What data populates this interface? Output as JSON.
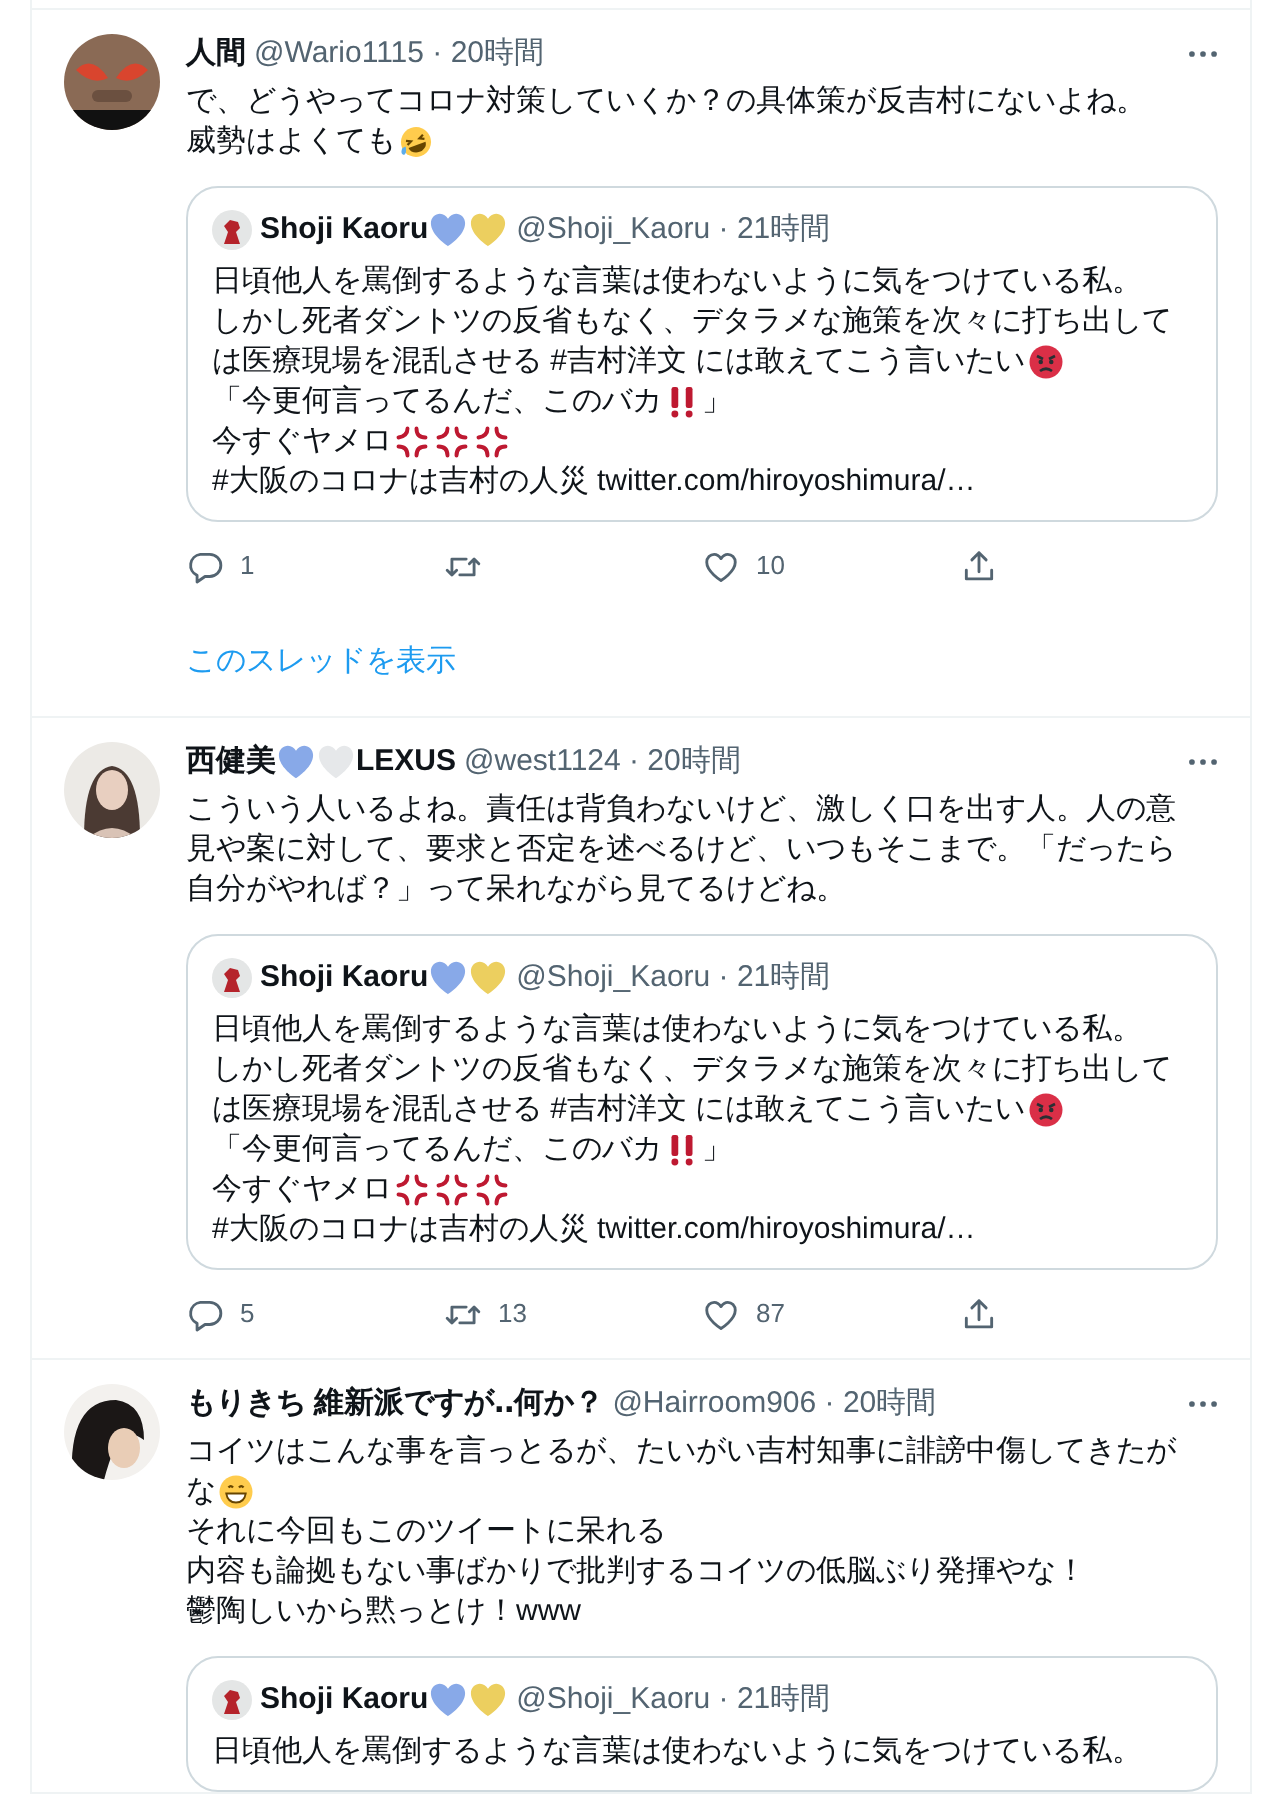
{
  "tweets": [
    {
      "author": {
        "name": [
          {
            "kind": "text",
            "text": "人間"
          }
        ],
        "meta": "@Wario1115 · 20時間"
      },
      "body": [
        [
          {
            "kind": "text",
            "text": "で、どうやってコロナ対策していくか？の具体策が反吉村にないよね。"
          }
        ],
        [
          {
            "kind": "text",
            "text": "威勢はよくても"
          },
          {
            "kind": "laugh"
          }
        ]
      ],
      "quote": {
        "name": [
          {
            "kind": "text",
            "text": "Shoji Kaoru"
          },
          {
            "kind": "heart",
            "color": "#88a9e8"
          },
          {
            "kind": "heart",
            "color": "#eccf5f"
          }
        ],
        "meta": "@Shoji_Kaoru · 21時間",
        "body": [
          [
            {
              "kind": "text",
              "text": "日頃他人を罵倒するような言葉は使わないように気をつけている私。"
            }
          ],
          [
            {
              "kind": "text",
              "text": "しかし死者ダントツの反省もなく、デタラメな施策を次々に打ち出して"
            }
          ],
          [
            {
              "kind": "text",
              "text": "は医療現場を混乱させる #吉村洋文 には敢えてこう言いたい"
            },
            {
              "kind": "angry"
            }
          ],
          [
            {
              "kind": "text",
              "text": "「今更何言ってるんだ、このバカ"
            },
            {
              "kind": "bangbang"
            },
            {
              "kind": "text",
              "text": "」"
            }
          ],
          [
            {
              "kind": "text",
              "text": "今すぐヤメロ"
            },
            {
              "kind": "anger"
            },
            {
              "kind": "anger"
            },
            {
              "kind": "anger"
            }
          ],
          [
            {
              "kind": "text",
              "text": "#大阪のコロナは吉村の人災 twitter.com/hiroyoshimura/…"
            }
          ]
        ]
      },
      "actions": [
        {
          "kind": "reply",
          "count": "1"
        },
        {
          "kind": "retweet"
        },
        {
          "kind": "like",
          "count": "10"
        },
        {
          "kind": "share"
        }
      ],
      "thread_link": "このスレッドを表示"
    },
    {
      "author": {
        "name": [
          {
            "kind": "text",
            "text": "西健美"
          },
          {
            "kind": "heart",
            "color": "#88a9e8"
          },
          {
            "kind": "heart",
            "color": "#e6e8ea"
          },
          {
            "kind": "text",
            "text": "LEXUS"
          }
        ],
        "meta": "@west1124 · 20時間"
      },
      "body": [
        [
          {
            "kind": "text",
            "text": "こういう人いるよね。責任は背負わないけど、激しく口を出す人。人の意"
          }
        ],
        [
          {
            "kind": "text",
            "text": "見や案に対して、要求と否定を述べるけど、いつもそこまで。「だったら"
          }
        ],
        [
          {
            "kind": "text",
            "text": "自分がやれば？」って呆れながら見てるけどね。"
          }
        ]
      ],
      "quote": {
        "name": [
          {
            "kind": "text",
            "text": "Shoji Kaoru"
          },
          {
            "kind": "heart",
            "color": "#88a9e8"
          },
          {
            "kind": "heart",
            "color": "#eccf5f"
          }
        ],
        "meta": "@Shoji_Kaoru · 21時間",
        "body": [
          [
            {
              "kind": "text",
              "text": "日頃他人を罵倒するような言葉は使わないように気をつけている私。"
            }
          ],
          [
            {
              "kind": "text",
              "text": "しかし死者ダントツの反省もなく、デタラメな施策を次々に打ち出して"
            }
          ],
          [
            {
              "kind": "text",
              "text": "は医療現場を混乱させる #吉村洋文 には敢えてこう言いたい"
            },
            {
              "kind": "angry"
            }
          ],
          [
            {
              "kind": "text",
              "text": "「今更何言ってるんだ、このバカ"
            },
            {
              "kind": "bangbang"
            },
            {
              "kind": "text",
              "text": "」"
            }
          ],
          [
            {
              "kind": "text",
              "text": "今すぐヤメロ"
            },
            {
              "kind": "anger"
            },
            {
              "kind": "anger"
            },
            {
              "kind": "anger"
            }
          ],
          [
            {
              "kind": "text",
              "text": "#大阪のコロナは吉村の人災 twitter.com/hiroyoshimura/…"
            }
          ]
        ]
      },
      "actions": [
        {
          "kind": "reply",
          "count": "5"
        },
        {
          "kind": "retweet",
          "count": "13"
        },
        {
          "kind": "like",
          "count": "87"
        },
        {
          "kind": "share"
        }
      ]
    },
    {
      "author": {
        "name": [
          {
            "kind": "text",
            "text": "もりきち 維新派ですが‥何か？"
          }
        ],
        "meta": "@Hairroom906 · 20時間"
      },
      "body": [
        [
          {
            "kind": "text",
            "text": "コイツはこんな事を言っとるが、たいがい吉村知事に誹謗中傷してきたが"
          }
        ],
        [
          {
            "kind": "text",
            "text": "な"
          },
          {
            "kind": "grin"
          }
        ],
        [
          {
            "kind": "text",
            "text": "それに今回もこのツイートに呆れる"
          }
        ],
        [
          {
            "kind": "text",
            "text": "内容も論拠もない事ばかりで批判するコイツの低脳ぶり発揮やな！"
          }
        ],
        [
          {
            "kind": "text",
            "text": "鬱陶しいから黙っとけ！www"
          }
        ]
      ],
      "quote": {
        "name": [
          {
            "kind": "text",
            "text": "Shoji Kaoru"
          },
          {
            "kind": "heart",
            "color": "#88a9e8"
          },
          {
            "kind": "heart",
            "color": "#eccf5f"
          }
        ],
        "meta": "@Shoji_Kaoru · 21時間",
        "body": [
          [
            {
              "kind": "text",
              "text": "日頃他人を罵倒するような言葉は使わないように気をつけている私。"
            }
          ]
        ]
      }
    }
  ]
}
